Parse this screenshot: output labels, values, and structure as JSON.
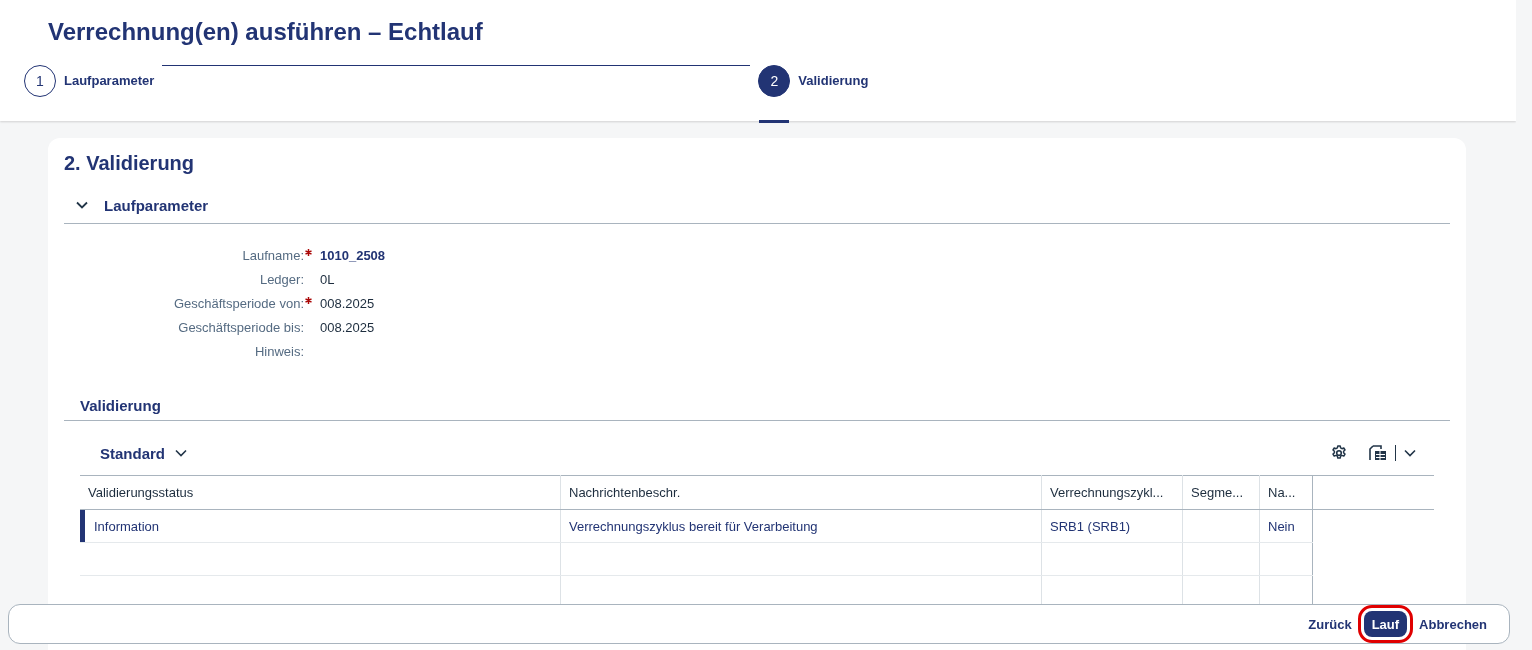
{
  "title": "Verrechnung(en) ausführen – Echtlauf",
  "steps": [
    {
      "number": "1",
      "label": "Laufparameter",
      "selected": false
    },
    {
      "number": "2",
      "label": "Validierung",
      "selected": true
    }
  ],
  "section_title": "2. Validierung",
  "parameter_group": {
    "title": "Laufparameter",
    "expanded": true,
    "fields": [
      {
        "label": "Laufname:",
        "required": true,
        "value": "1010_2508",
        "emphasized": true
      },
      {
        "label": "Ledger:",
        "required": false,
        "value": "0L",
        "emphasized": false
      },
      {
        "label": "Geschäftsperiode von:",
        "required": true,
        "value": "008.2025",
        "emphasized": false
      },
      {
        "label": "Geschäftsperiode bis:",
        "required": false,
        "value": "008.2025",
        "emphasized": false
      },
      {
        "label": "Hinweis:",
        "required": false
      }
    ]
  },
  "validation_group": {
    "title": "Validierung",
    "variant": "Standard",
    "table": {
      "columns": [
        "Validierungsstatus",
        "Nachrichtenbeschr.",
        "Verrechnungszykl...",
        "Segme...",
        "Na..."
      ],
      "rows": [
        {
          "cells": [
            "Information",
            "Verrechnungszyklus bereit für Verarbeitung",
            "SRB1 (SRB1)",
            "",
            "Nein"
          ],
          "selected": true
        }
      ]
    }
  },
  "footer": {
    "buttons": [
      {
        "label": "Zurück",
        "kind": "ghost",
        "highlighted": false
      },
      {
        "label": "Lauf",
        "kind": "primary",
        "highlighted": true
      },
      {
        "label": "Abbrechen",
        "kind": "ghost",
        "highlighted": false
      }
    ]
  }
}
